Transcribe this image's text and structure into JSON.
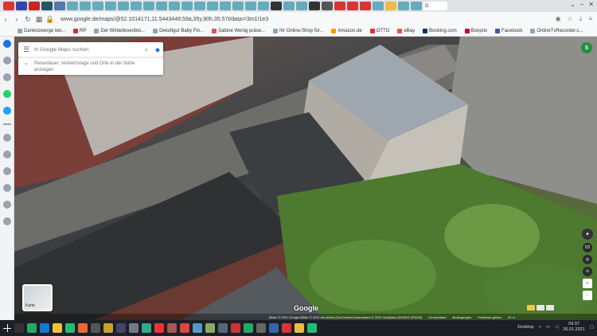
{
  "browser": {
    "active_tab_label": "G",
    "url": "www.google.de/maps/@52.1014171,11.5443448,59a,35y,90h,35.57t/data=!3m1!1e3",
    "tabs_right_icons": [
      "dropdown-icon",
      "minimize-icon",
      "close-icon"
    ]
  },
  "bookmarks": [
    {
      "label": "Dartenzwerge bei..."
    },
    {
      "label": "RP"
    },
    {
      "label": "Der Wirbellosenblo..."
    },
    {
      "label": "Dekofigur Baby Fin..."
    },
    {
      "label": "Sabine Wenig präse..."
    },
    {
      "label": "Ihr Online-Shop für..."
    },
    {
      "label": "Amazon.de"
    },
    {
      "label": "OTTO"
    },
    {
      "label": "eBay"
    },
    {
      "label": "Booking.com"
    },
    {
      "label": "Bonprix"
    },
    {
      "label": "Facebook"
    },
    {
      "label": "OnlineTvRecorder.c..."
    }
  ],
  "maps": {
    "search_placeholder": "In Google Maps suchen",
    "info_text": "Reisedauer, Verkehrslage und Orte in der Nähe anzeigen",
    "avatar_letter": "S",
    "layers_label": "Karte",
    "google_logo": "Google",
    "attribution": "Bilder © 2021 Google,Bilder © 2021 AeroWest,GeoContent,Kartendaten © 2021 GeoBasis-DE/BKG (©2009)",
    "country": "Deutschland",
    "terms": "Bedingungen",
    "feedback": "Feedback geben",
    "scale": "20 m",
    "mode_2d": "2D"
  },
  "taskbar": {
    "desktop_label": "Desktop",
    "time": "09:37",
    "date": "26.01.2021"
  }
}
